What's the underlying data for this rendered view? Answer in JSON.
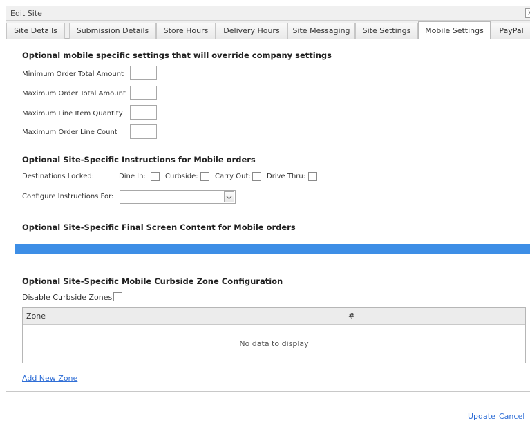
{
  "window": {
    "title": "Edit Site",
    "close_glyph": "x"
  },
  "tabs": [
    {
      "label": "Site Details"
    },
    {
      "label": "Submission Details"
    },
    {
      "label": "Store Hours"
    },
    {
      "label": "Delivery Hours"
    },
    {
      "label": "Site Messaging"
    },
    {
      "label": "Site Settings"
    },
    {
      "label": "Mobile Settings",
      "active": true
    },
    {
      "label": "PayPal"
    }
  ],
  "mobile_settings": {
    "heading": "Optional mobile specific settings that will override company settings",
    "fields": [
      {
        "label": "Minimum Order Total Amount",
        "value": ""
      },
      {
        "label": "Maximum Order Total Amount",
        "value": ""
      },
      {
        "label": "Maximum Line Item Quantity",
        "value": ""
      },
      {
        "label": "Maximum Order Line Count",
        "value": ""
      }
    ]
  },
  "instructions": {
    "heading": "Optional Site-Specific Instructions for Mobile orders",
    "destinations_label": "Destinations Locked:",
    "destinations": [
      {
        "label": "Dine In:",
        "checked": false
      },
      {
        "label": "Curbside:",
        "checked": false
      },
      {
        "label": "Carry Out:",
        "checked": false
      },
      {
        "label": "Drive Thru:",
        "checked": false
      }
    ],
    "configure_label": "Configure Instructions For:",
    "configure_value": ""
  },
  "final_screen": {
    "heading": "Optional Site-Specific Final Screen Content for Mobile orders",
    "bar_color": "#3d8ee6"
  },
  "curbside": {
    "heading": "Optional Site-Specific Mobile Curbside Zone Configuration",
    "disable_label": "Disable Curbside Zones:",
    "disable_checked": false,
    "grid": {
      "columns": [
        "Zone",
        "#"
      ],
      "empty_text": "No data to display"
    },
    "add_link": "Add New Zone"
  },
  "footer": {
    "update_label": "Update",
    "cancel_label": "Cancel"
  },
  "colors": {
    "link": "#2f6ed6",
    "accent": "#3d8ee6"
  }
}
